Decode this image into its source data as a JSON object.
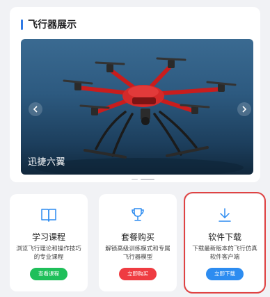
{
  "showcase": {
    "title": "飞行器展示",
    "slide_caption": "迅捷六翼",
    "slide_count": 2,
    "active_slide": 2
  },
  "features": [
    {
      "name": "学习课程",
      "desc": "浏览飞行理论和操作技巧的专业课程",
      "button": "查看课程",
      "icon": "book-icon",
      "button_color": "#1fbf5a"
    },
    {
      "name": "套餐购买",
      "desc": "解锁高级训练模式和专属飞行器模型",
      "button": "立即购买",
      "icon": "trophy-icon",
      "button_color": "#ef3c42"
    },
    {
      "name": "软件下载",
      "desc": "下载最新版本的飞行仿真软件客户端",
      "button": "立即下载",
      "icon": "download-icon",
      "button_color": "#2d8cf0"
    }
  ],
  "colors": {
    "accent": "#2f7ae5",
    "highlight_border": "#e04343"
  }
}
